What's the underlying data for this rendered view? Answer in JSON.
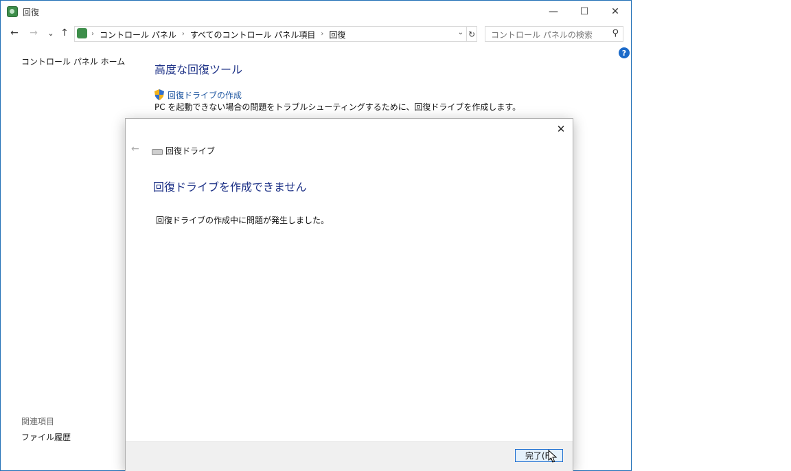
{
  "window": {
    "title": "回復"
  },
  "titlebar": {
    "minimize": "—",
    "maximize": "☐",
    "close": "✕"
  },
  "nav": {
    "back_icon": "←",
    "forward_icon": "→",
    "recent_icon": "⌄",
    "up_icon": "↑",
    "breadcrumbs": [
      "コントロール パネル",
      "すべてのコントロール パネル項目",
      "回復"
    ],
    "crumb_separator": "›",
    "dropdown_icon": "⌄",
    "refresh_icon": "↻",
    "search_placeholder": "コントロール パネルの検索",
    "search_icon": "⚲"
  },
  "help_icon": "?",
  "sidebar": {
    "home": "コントロール パネル ホーム",
    "related_heading": "関連項目",
    "related_items": [
      "ファイル履歴"
    ]
  },
  "main": {
    "heading": "高度な回復ツール",
    "create_link": "回復ドライブの作成",
    "create_desc": "PC を起動できない場合の問題をトラブルシューティングするために、回復ドライブを作成します。"
  },
  "dialog": {
    "close_icon": "✕",
    "back_icon": "←",
    "title": "回復ドライブ",
    "heading": "回復ドライブを作成できません",
    "message": "回復ドライブの作成中に問題が発生しました。",
    "finish_button": "完了(F)"
  },
  "colors": {
    "heading_blue": "#1e3287",
    "link_blue": "#1e56a0",
    "button_border": "#1e6fd0"
  }
}
